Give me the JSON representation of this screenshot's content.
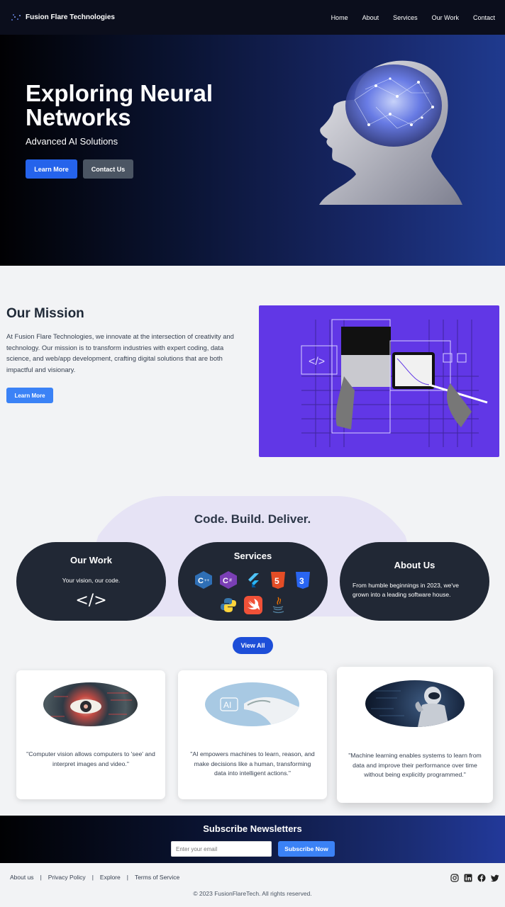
{
  "nav": {
    "brand": "Fusion Flare Technologies",
    "items": [
      {
        "label": "Home"
      },
      {
        "label": "About"
      },
      {
        "label": "Services"
      },
      {
        "label": "Our Work"
      },
      {
        "label": "Contact"
      }
    ]
  },
  "hero": {
    "title": "Exploring Neural Networks",
    "subtitle": "Advanced AI Solutions",
    "primary_button": "Learn More",
    "secondary_button": "Contact Us"
  },
  "mission": {
    "title": "Our Mission",
    "text": "At Fusion Flare Technologies, we innovate at the intersection of creativity and technology. Our mission is to transform industries with expert coding, data science, and web/app development, crafting digital solutions that are both impactful and visionary.",
    "button": "Learn More"
  },
  "highlights": {
    "heading": "Code. Build. Deliver.",
    "our_work": {
      "title": "Our Work",
      "text": "Your vision, our code.",
      "symbol": "</>"
    },
    "services": {
      "title": "Services",
      "icons": [
        "c-plus-plus-icon",
        "c-sharp-icon",
        "flutter-icon",
        "html5-icon",
        "css3-icon",
        "python-icon",
        "swift-icon",
        "java-icon"
      ]
    },
    "about": {
      "title": "About Us",
      "text": "From humble beginnings in 2023, we've grown into a leading software house."
    },
    "view_all": "View All"
  },
  "cards": [
    {
      "quote": "\"Computer vision allows computers to 'see' and interpret images and video.\""
    },
    {
      "quote": "\"AI empowers machines to learn, reason, and make decisions like a human, transforming data into intelligent actions.\"",
      "image_label": "AI"
    },
    {
      "quote": "\"Machine learning enables systems to learn from data and improve their performance over time without being explicitly programmed.\""
    }
  ],
  "newsletter": {
    "title": "Subscribe Newsletters",
    "placeholder": "Enter your email",
    "button": "Subscribe Now"
  },
  "footer": {
    "links": [
      "About us",
      "Privacy Policy",
      "Explore",
      "Terms of Service"
    ],
    "separator": "|",
    "social": [
      "instagram-icon",
      "linkedin-icon",
      "facebook-icon",
      "twitter-icon"
    ],
    "copyright": "© 2023 FusionFlareTech. All rights reserved."
  },
  "colors": {
    "accent": "#2563eb",
    "dark": "#212835",
    "mission_bg": "#6137e6"
  }
}
